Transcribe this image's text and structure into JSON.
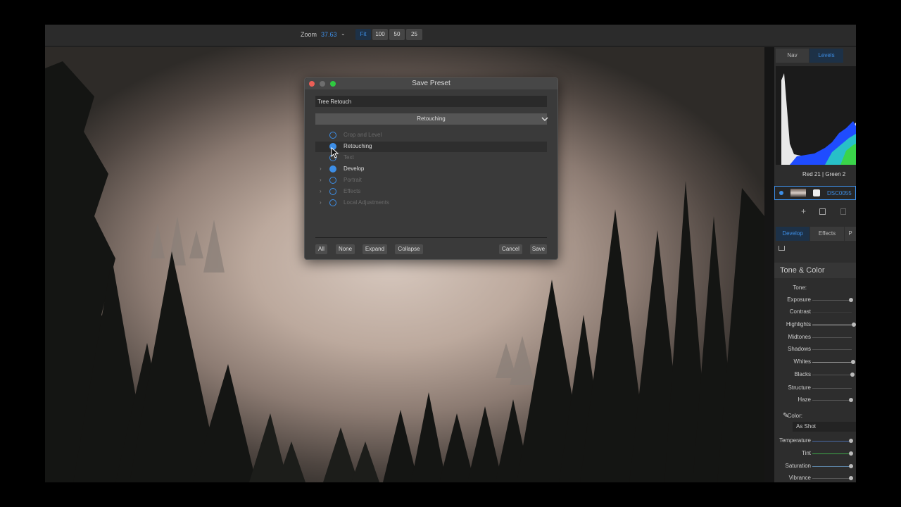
{
  "toolbar": {
    "zoom_label": "Zoom",
    "zoom_value": "37.63",
    "zoom_buttons": [
      "Fit",
      "100",
      "50",
      "25"
    ]
  },
  "right_panel": {
    "top_tabs": [
      "Nav",
      "Levels"
    ],
    "rgb_readout": "Red  21  | Green  2",
    "layer_name": "DSC0055",
    "module_tabs": [
      "Develop",
      "Effects",
      "P"
    ],
    "section_title": "Tone & Color",
    "tone_label": "Tone:",
    "sliders": [
      "Exposure",
      "Contrast",
      "Highlights",
      "Midtones",
      "Shadows",
      "Whites",
      "Blacks",
      "Structure",
      "Haze"
    ],
    "color_label": "Color:",
    "wb_value": "As Shot",
    "color_sliders": [
      "Temperature",
      "Tint",
      "Saturation",
      "Vibrance"
    ]
  },
  "dialog": {
    "title": "Save Preset",
    "name_value": "Tree Retouch",
    "group_value": "Retouching",
    "items": [
      {
        "label": "Crop and Level",
        "checked": false,
        "expandable": false,
        "dim": true
      },
      {
        "label": "Retouching",
        "checked": true,
        "expandable": false,
        "dim": false,
        "selected": true
      },
      {
        "label": "Text",
        "checked": false,
        "expandable": false,
        "dim": true
      },
      {
        "label": "Develop",
        "checked": true,
        "expandable": true,
        "dim": false
      },
      {
        "label": "Portrait",
        "checked": false,
        "expandable": true,
        "dim": true
      },
      {
        "label": "Effects",
        "checked": false,
        "expandable": true,
        "dim": true
      },
      {
        "label": "Local Adjustments",
        "checked": false,
        "expandable": true,
        "dim": true
      }
    ],
    "buttons": {
      "all": "All",
      "none": "None",
      "expand": "Expand",
      "collapse": "Collapse",
      "cancel": "Cancel",
      "save": "Save"
    }
  },
  "colors": {
    "accent": "#3d8ee6",
    "traffic_red": "#ec5f57",
    "traffic_gray": "#6e6e6e",
    "traffic_green": "#2fc940"
  }
}
